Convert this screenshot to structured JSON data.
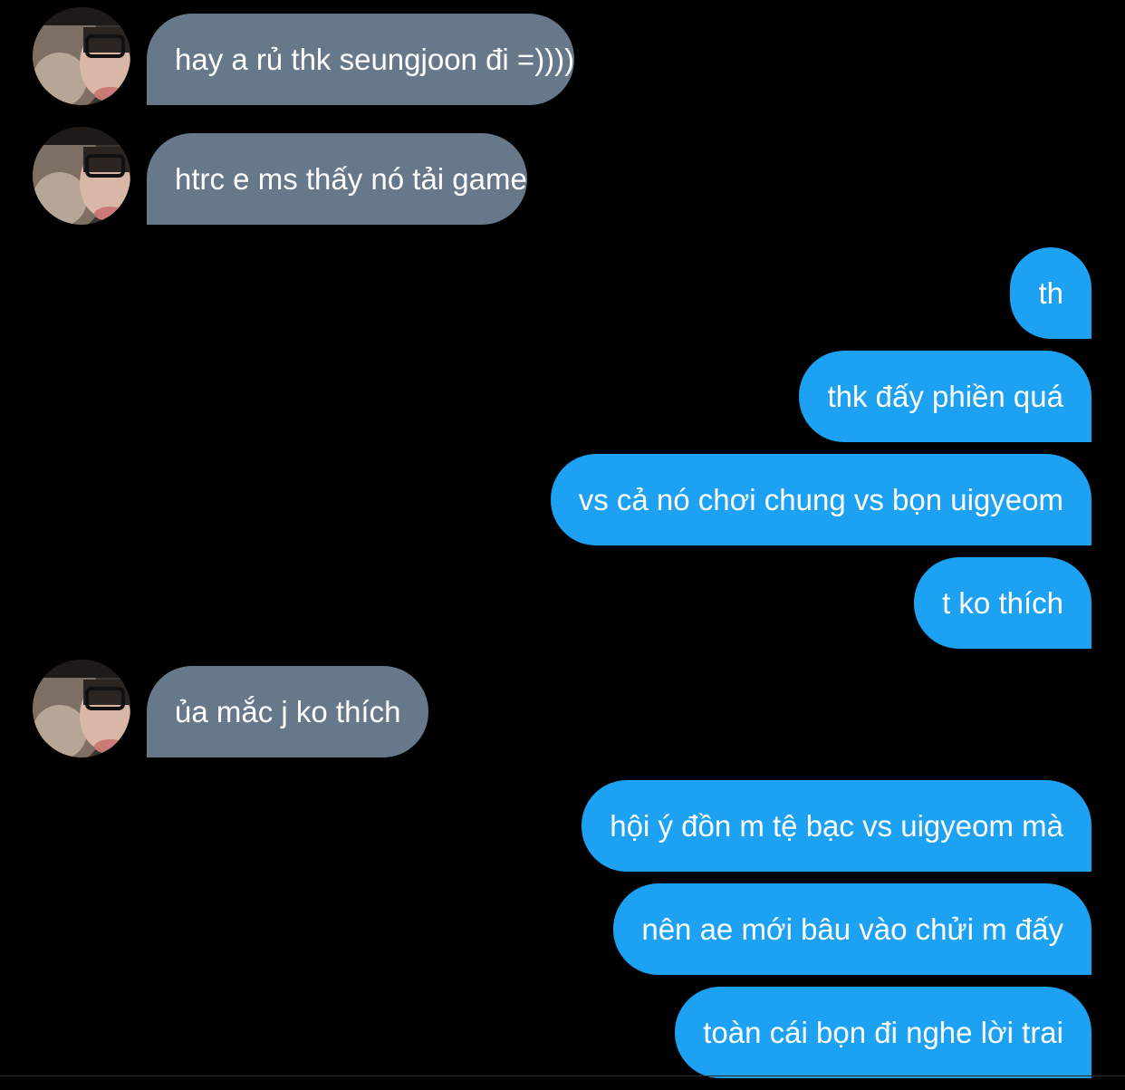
{
  "conversation": {
    "messages": [
      {
        "side": "incoming",
        "text": "hay a rủ thk seungjoon đi =))))"
      },
      {
        "side": "incoming",
        "text": "htrc e ms thấy nó tải game"
      },
      {
        "side": "outgoing",
        "text": "th"
      },
      {
        "side": "outgoing",
        "text": "thk đấy phiền quá"
      },
      {
        "side": "outgoing",
        "text": "vs cả nó chơi chung vs bọn uigyeom"
      },
      {
        "side": "outgoing",
        "text": "t ko thích"
      },
      {
        "side": "incoming",
        "text": "ủa mắc j ko thích"
      },
      {
        "side": "outgoing",
        "text": "hội ý đồn m tệ bạc vs uigyeom mà"
      },
      {
        "side": "outgoing",
        "text": "nên ae mới bâu vào chửi m đấy"
      },
      {
        "side": "outgoing",
        "text": "toàn cái bọn đi nghe lời trai"
      }
    ]
  },
  "colors": {
    "background": "#000000",
    "incoming_bubble": "#66788a",
    "outgoing_bubble": "#1da1f2",
    "text": "#ffffff"
  },
  "icons": {
    "avatar": "profile-photo-avatar"
  }
}
